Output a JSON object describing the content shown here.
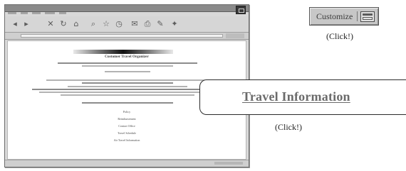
{
  "window": {
    "page_title": "Customer Travel Organizer",
    "links": [
      "Policy",
      "Reimbursement",
      "Contact Office",
      "Travel Schedule",
      "Air Travel Information"
    ]
  },
  "customize_button": {
    "label": "Customize",
    "icon": "window-layout-icon"
  },
  "notes": {
    "click_top": "(Click!)",
    "click_bottom": "(Click!)"
  },
  "travel_link": {
    "label": "Travel Information"
  },
  "colors": {
    "window_chrome": "#d9d9d9",
    "button_face": "#c7c7c7",
    "link_text": "#6b6b6b"
  }
}
